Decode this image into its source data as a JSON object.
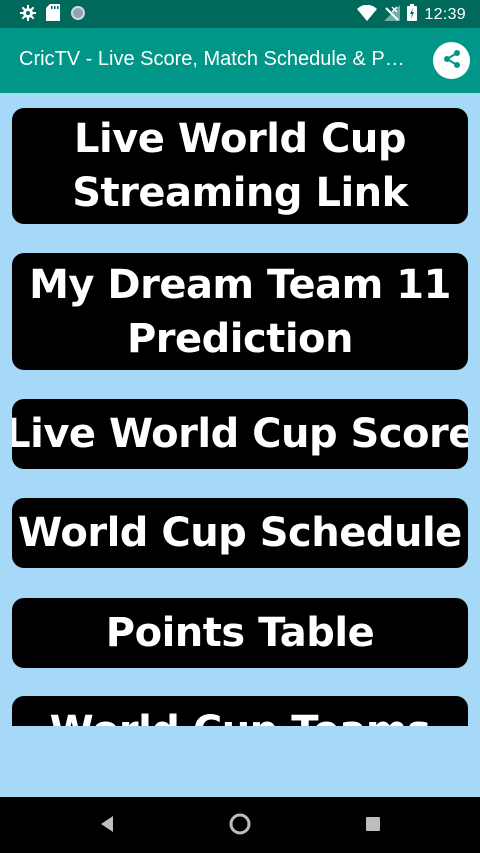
{
  "status_bar": {
    "time": "12:39",
    "left_icons": [
      "gear-icon",
      "sd-card-icon",
      "circle-icon"
    ],
    "right_icons": [
      "wifi-icon",
      "no-signal-icon",
      "battery-icon"
    ]
  },
  "app_bar": {
    "title": "CricTV - Live Score, Match Schedule & Points Table",
    "share_icon": "share-icon",
    "color": "#009688"
  },
  "menu": [
    {
      "lines": [
        "Live World Cup",
        "Streaming Link"
      ]
    },
    {
      "lines": [
        "My Dream Team 11",
        "Prediction"
      ]
    },
    {
      "lines": [
        "Live World Cup Score"
      ]
    },
    {
      "lines": [
        "World Cup Schedule"
      ]
    },
    {
      "lines": [
        "Points Table"
      ]
    },
    {
      "lines": [
        "World Cup Teams"
      ]
    }
  ],
  "nav_bar": {
    "icons": [
      "back-icon",
      "home-icon",
      "recents-icon"
    ]
  },
  "colors": {
    "background": "#a6d9f7",
    "button": "#000000",
    "status_bar": "#00695c"
  }
}
